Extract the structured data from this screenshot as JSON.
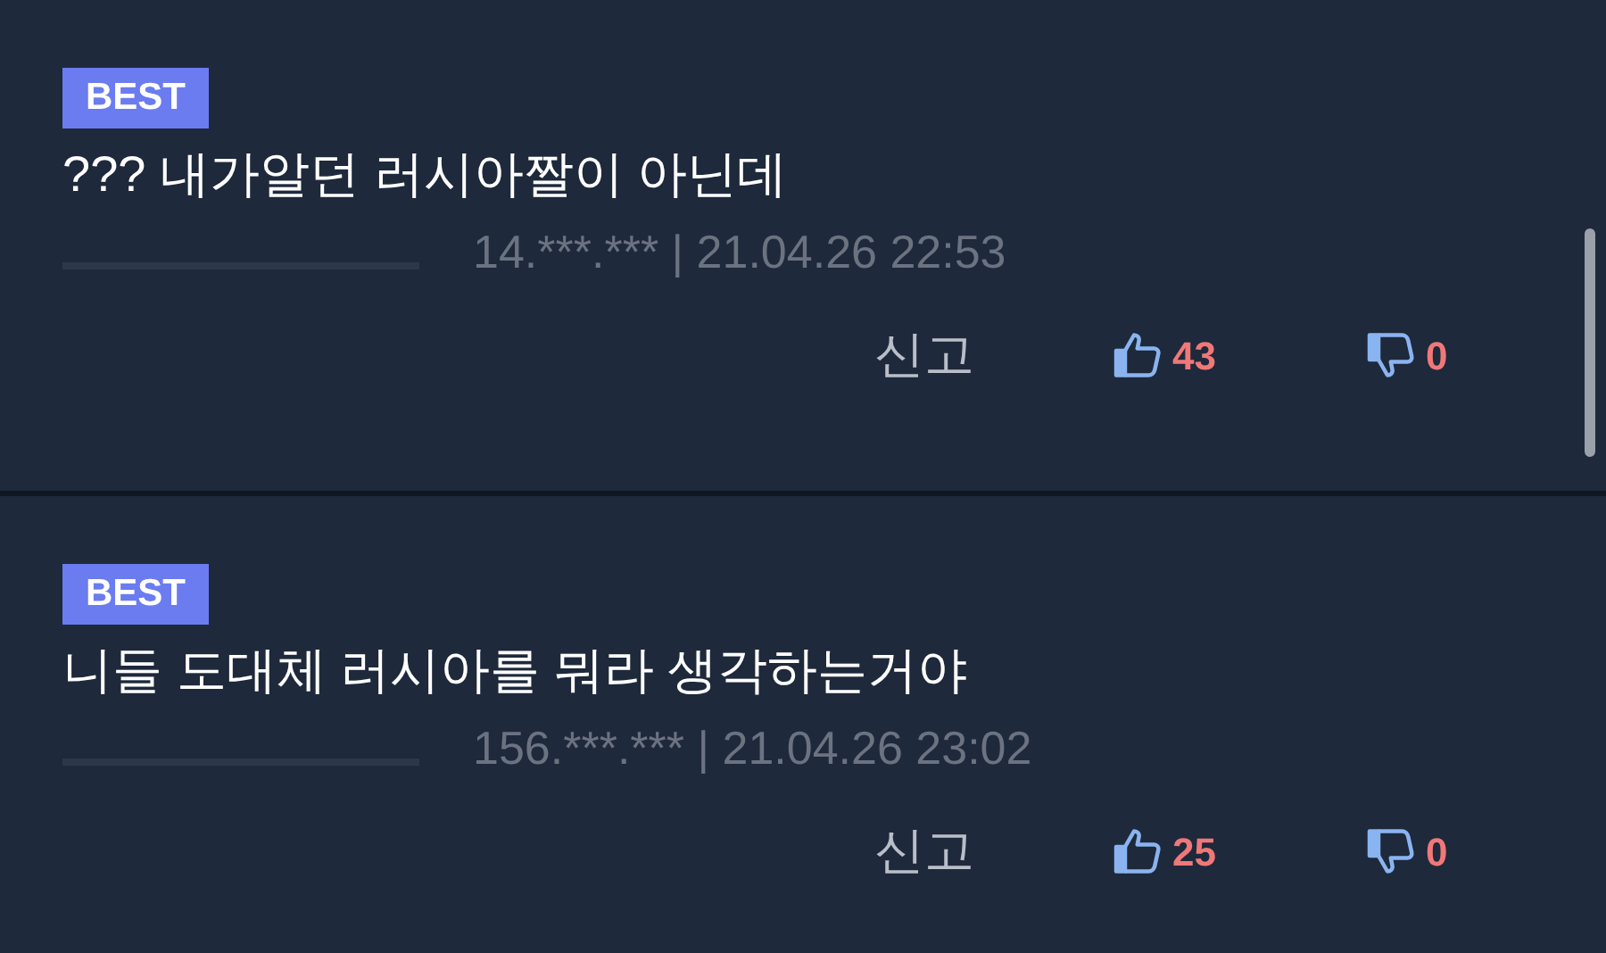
{
  "comments": [
    {
      "badge": "BEST",
      "text": "??? 내가알던 러시아짤이 아닌데",
      "meta": "14.***.*** | 21.04.26 22:53",
      "report": "신고",
      "likes": "43",
      "dislikes": "0"
    },
    {
      "badge": "BEST",
      "text": "니들 도대체 러시아를 뭐라 생각하는거야",
      "meta": "156.***.*** | 21.04.26 23:02",
      "report": "신고",
      "likes": "25",
      "dislikes": "0"
    }
  ]
}
